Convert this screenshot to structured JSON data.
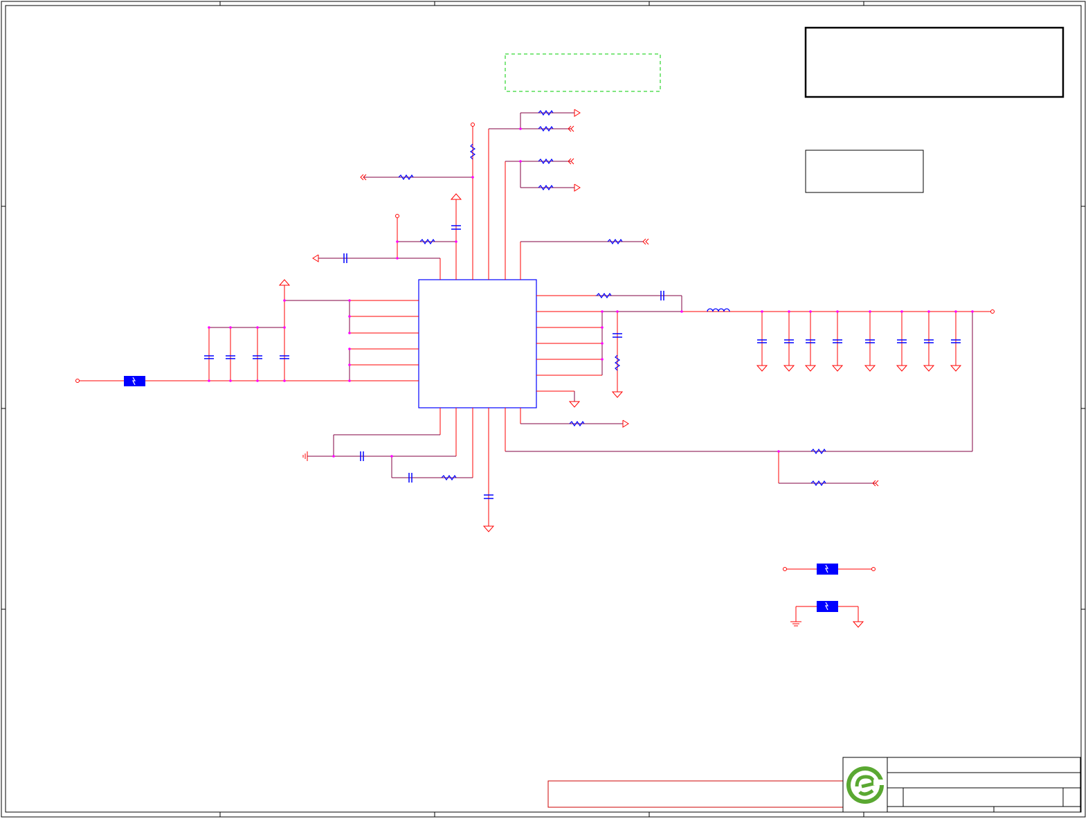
{
  "colors": {
    "background": "#ffffff",
    "frame": "#000000",
    "wire_red": "#ff0000",
    "wire_purple": "#800040",
    "component_blue": "#0000ff",
    "junction": "#ff00ff",
    "note_box_dashed": "#00cc00",
    "disclaimer_box": "#cc0000",
    "logo_green": "#5aa832"
  },
  "icons": {
    "ferrite": "ferrite-bead-icon",
    "resistor": "resistor-icon",
    "capacitor": "capacitor-icon",
    "inductor": "inductor-icon",
    "ground": "ground-icon",
    "logo": "company-logo-icon"
  }
}
